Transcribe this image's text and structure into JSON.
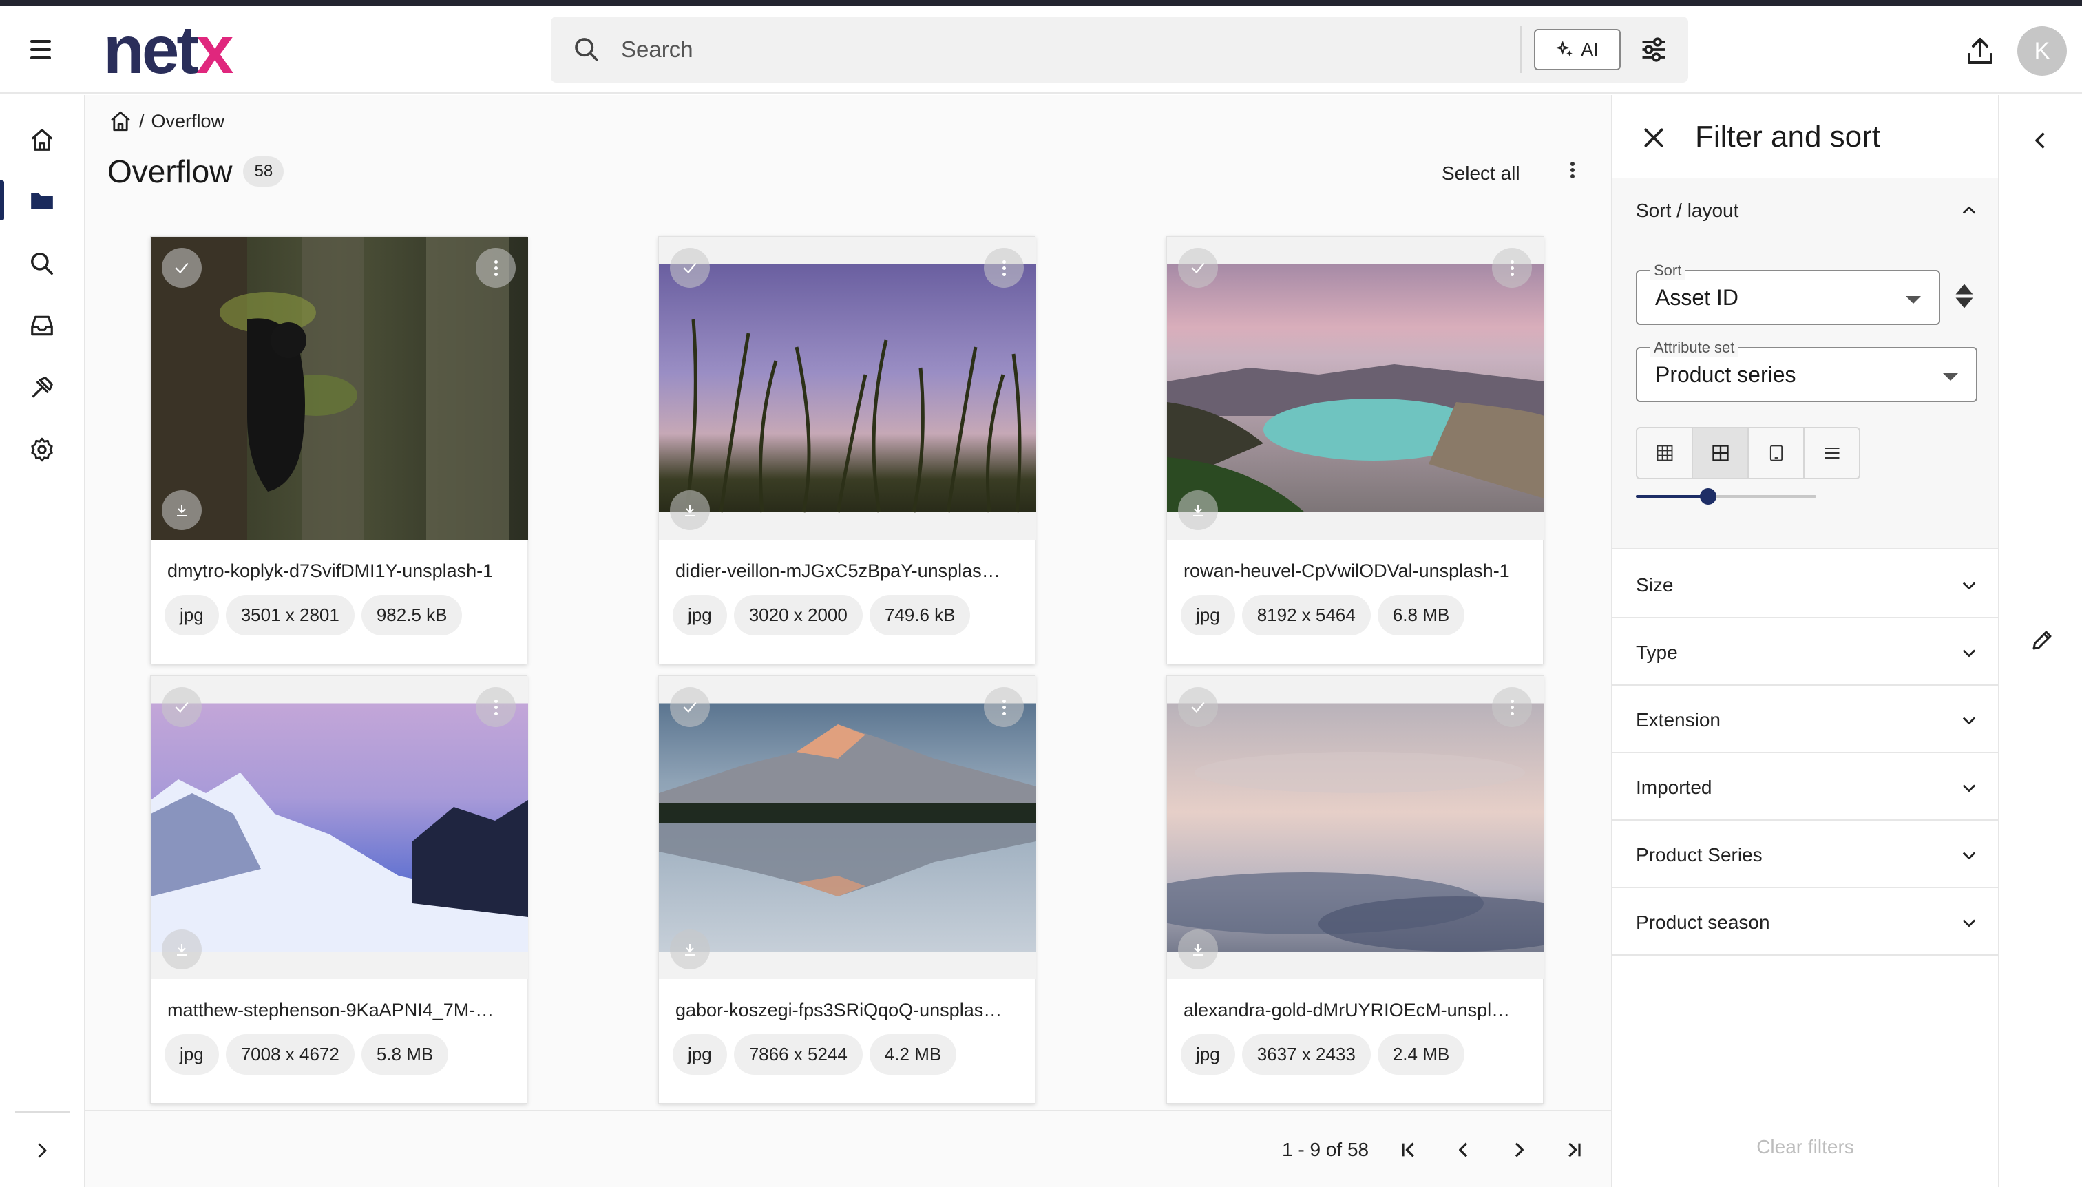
{
  "header": {
    "menu_icon": "hamburger-icon",
    "logo": "netx",
    "search_placeholder": "Search",
    "ai_label": "AI",
    "avatar_initial": "K"
  },
  "rail": {
    "items": [
      {
        "name": "home-icon"
      },
      {
        "name": "folder-icon"
      },
      {
        "name": "search-icon"
      },
      {
        "name": "inbox-icon"
      },
      {
        "name": "hammer-icon"
      },
      {
        "name": "gear-icon"
      }
    ]
  },
  "breadcrumb": {
    "separator": "/",
    "current": "Overflow"
  },
  "page": {
    "title": "Overflow",
    "count": "58",
    "select_all": "Select all"
  },
  "cards": [
    {
      "name": "dmytro-koplyk-d7SvifDMI1Y-unsplash-1",
      "ext": "jpg",
      "dims": "3501 x 2801",
      "size": "982.5 kB"
    },
    {
      "name": "didier-veillon-mJGxC5zBpaY-unsplas…",
      "ext": "jpg",
      "dims": "3020 x 2000",
      "size": "749.6 kB"
    },
    {
      "name": "rowan-heuvel-CpVwilODVal-unsplash-1",
      "ext": "jpg",
      "dims": "8192 x 5464",
      "size": "6.8 MB"
    },
    {
      "name": "matthew-stephenson-9KaAPNI4_7M-…",
      "ext": "jpg",
      "dims": "7008 x 4672",
      "size": "5.8 MB"
    },
    {
      "name": "gabor-koszegi-fps3SRiQqoQ-unsplas…",
      "ext": "jpg",
      "dims": "7866 x 5244",
      "size": "4.2 MB"
    },
    {
      "name": "alexandra-gold-dMrUYRIOEcM-unspl…",
      "ext": "jpg",
      "dims": "3637 x 2433",
      "size": "2.4 MB"
    }
  ],
  "pager": {
    "range": "1 - 9 of 58"
  },
  "filter_panel": {
    "title": "Filter and sort",
    "sort_section": "Sort / layout",
    "sort_label": "Sort",
    "sort_value": "Asset ID",
    "attr_label": "Attribute set",
    "attr_value": "Product series",
    "layout_options": [
      "grid-small-icon",
      "grid-large-icon",
      "tablet-icon",
      "list-icon"
    ],
    "layout_selected_index": 1,
    "thumb_size_fraction": 0.4,
    "sections": [
      "Size",
      "Type",
      "Extension",
      "Imported",
      "Product Series",
      "Product season"
    ],
    "clear_filters": "Clear filters"
  }
}
